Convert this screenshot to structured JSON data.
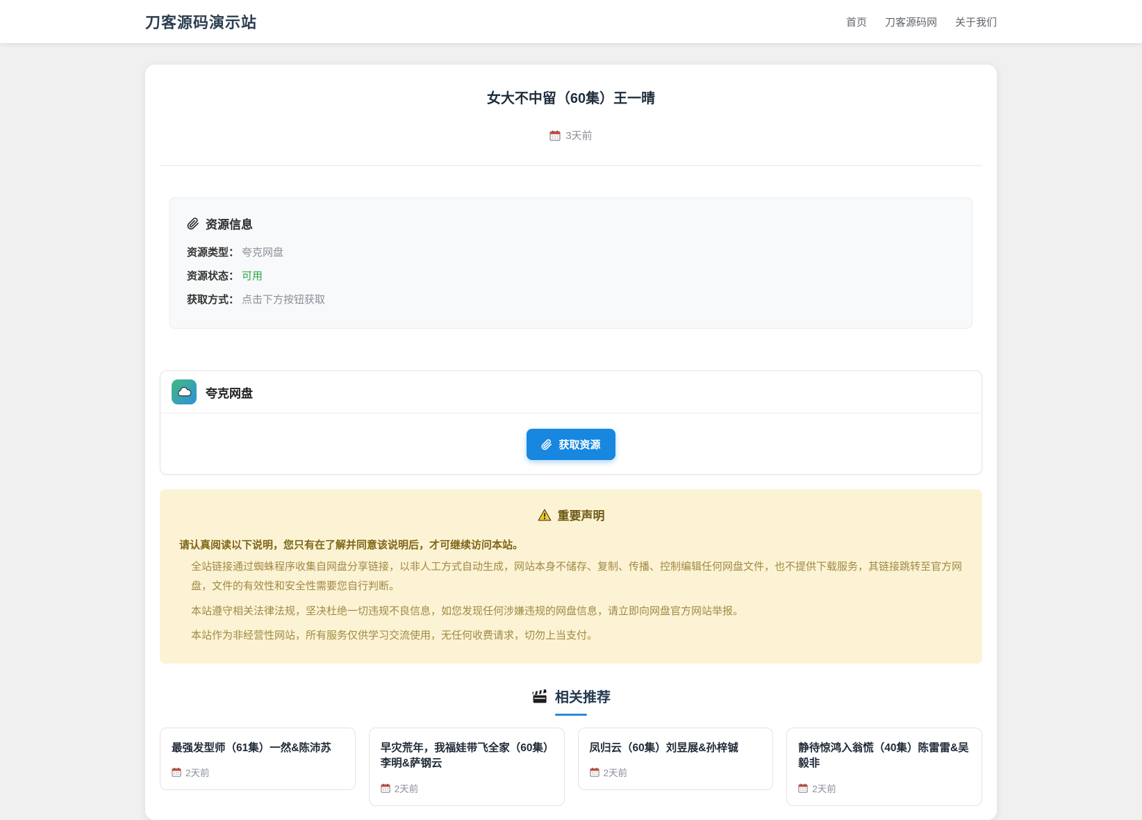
{
  "header": {
    "site_title": "刀客源码演示站",
    "nav": [
      {
        "label": "首页"
      },
      {
        "label": "刀客源码网"
      },
      {
        "label": "关于我们"
      }
    ]
  },
  "post": {
    "title": "女大不中留（60集）王一晴",
    "date": "3天前"
  },
  "resource_info": {
    "heading": "资源信息",
    "rows": [
      {
        "label": "资源类型：",
        "value": "夸克网盘"
      },
      {
        "label": "资源状态：",
        "value": "可用"
      },
      {
        "label": "获取方式：",
        "value": "点击下方按钮获取"
      }
    ]
  },
  "provider": {
    "name": "夸克网盘",
    "button_label": "获取资源"
  },
  "notice": {
    "heading": "重要声明",
    "intro": "请认真阅读以下说明，您只有在了解并同意该说明后，才可继续访问本站。",
    "paragraphs": [
      "全站链接通过蜘蛛程序收集自网盘分享链接，以非人工方式自动生成，网站本身不储存、复制、传播、控制编辑任何网盘文件，也不提供下载服务，其链接跳转至官方网盘，文件的有效性和安全性需要您自行判断。",
      "本站遵守相关法律法规，坚决杜绝一切违规不良信息，如您发现任何涉嫌违规的网盘信息，请立即向网盘官方网站举报。",
      "本站作为非经营性网站，所有服务仅供学习交流使用，无任何收费请求，切勿上当支付。"
    ]
  },
  "related": {
    "heading": "相关推荐",
    "items": [
      {
        "title": "最强发型师（61集）一然&陈沛苏",
        "date": "2天前"
      },
      {
        "title": "早灾荒年，我福娃带飞全家（60集）李明&萨钢云",
        "date": "2天前"
      },
      {
        "title": "凤归云（60集）刘昱展&孙梓铖",
        "date": "2天前"
      },
      {
        "title": "静待惊鸿入翁慌（40集）陈雷雷&吴毅非",
        "date": "2天前"
      }
    ]
  },
  "colors": {
    "brand_dark": "#2c3e50",
    "accent_blue": "#1787e0",
    "success_green": "#28a745",
    "notice_bg": "#fcf3d5"
  }
}
